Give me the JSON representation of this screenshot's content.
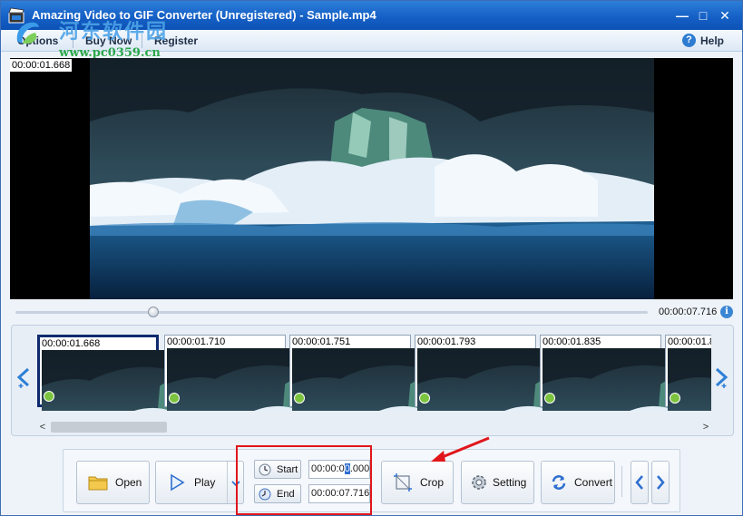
{
  "window": {
    "title": "Amazing Video to GIF Converter (Unregistered) - Sample.mp4",
    "controls": [
      "—",
      "□",
      "✕"
    ]
  },
  "menu": {
    "items": [
      "Options",
      "Buy Now",
      "Register"
    ],
    "help": "Help"
  },
  "watermark": {
    "title": "河东软件园",
    "url": "www.pc0359.cn"
  },
  "player": {
    "current_time": "00:00:01.668",
    "total_time": "00:00:07.716",
    "position": 0.22
  },
  "thumbnails": [
    {
      "time": "00:00:01.668",
      "selected": true
    },
    {
      "time": "00:00:01.710",
      "selected": false
    },
    {
      "time": "00:00:01.751",
      "selected": false
    },
    {
      "time": "00:00:01.793",
      "selected": false
    },
    {
      "time": "00:00:01.835",
      "selected": false
    },
    {
      "time": "00:00:01.8",
      "selected": false
    }
  ],
  "toolbar": {
    "open": "Open",
    "play": "Play",
    "start": "Start",
    "end": "End",
    "start_time_before": "00:00:0",
    "start_time_cursor": "0",
    "start_time_after": ".000",
    "end_time": "00:00:07.716",
    "crop": "Crop",
    "setting": "Setting",
    "convert": "Convert"
  },
  "colors": {
    "titlebar": "#1560c6",
    "selection": "#0e2a6e",
    "highlight": "#e0161b"
  }
}
